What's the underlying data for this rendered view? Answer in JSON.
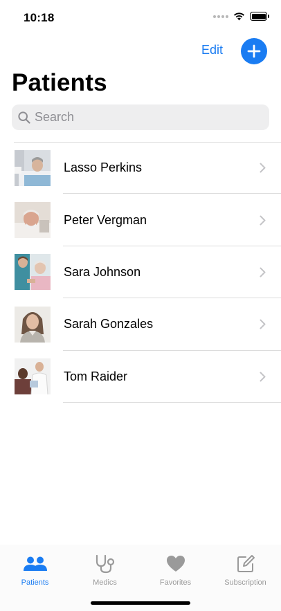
{
  "status_bar": {
    "time": "10:18"
  },
  "nav": {
    "edit_label": "Edit",
    "add_icon": "plus-icon"
  },
  "page": {
    "title": "Patients"
  },
  "search": {
    "placeholder": "Search",
    "value": ""
  },
  "patients": [
    {
      "name": "Lasso Perkins",
      "avatar": "patient-photo"
    },
    {
      "name": "Peter Vergman",
      "avatar": "patient-photo"
    },
    {
      "name": "Sara Johnson",
      "avatar": "patient-photo"
    },
    {
      "name": "Sarah Gonzales",
      "avatar": "patient-photo"
    },
    {
      "name": "Tom Raider",
      "avatar": "patient-photo"
    }
  ],
  "tabs": [
    {
      "label": "Patients",
      "icon": "people-icon",
      "active": true
    },
    {
      "label": "Medics",
      "icon": "stethoscope-icon",
      "active": false
    },
    {
      "label": "Favorites",
      "icon": "heart-icon",
      "active": false
    },
    {
      "label": "Subscription",
      "icon": "compose-icon",
      "active": false
    }
  ],
  "colors": {
    "accent": "#1a7cf2",
    "inactive": "#9a9a9a",
    "separator": "#dcdcdc",
    "search_bg": "#eeeeef"
  }
}
